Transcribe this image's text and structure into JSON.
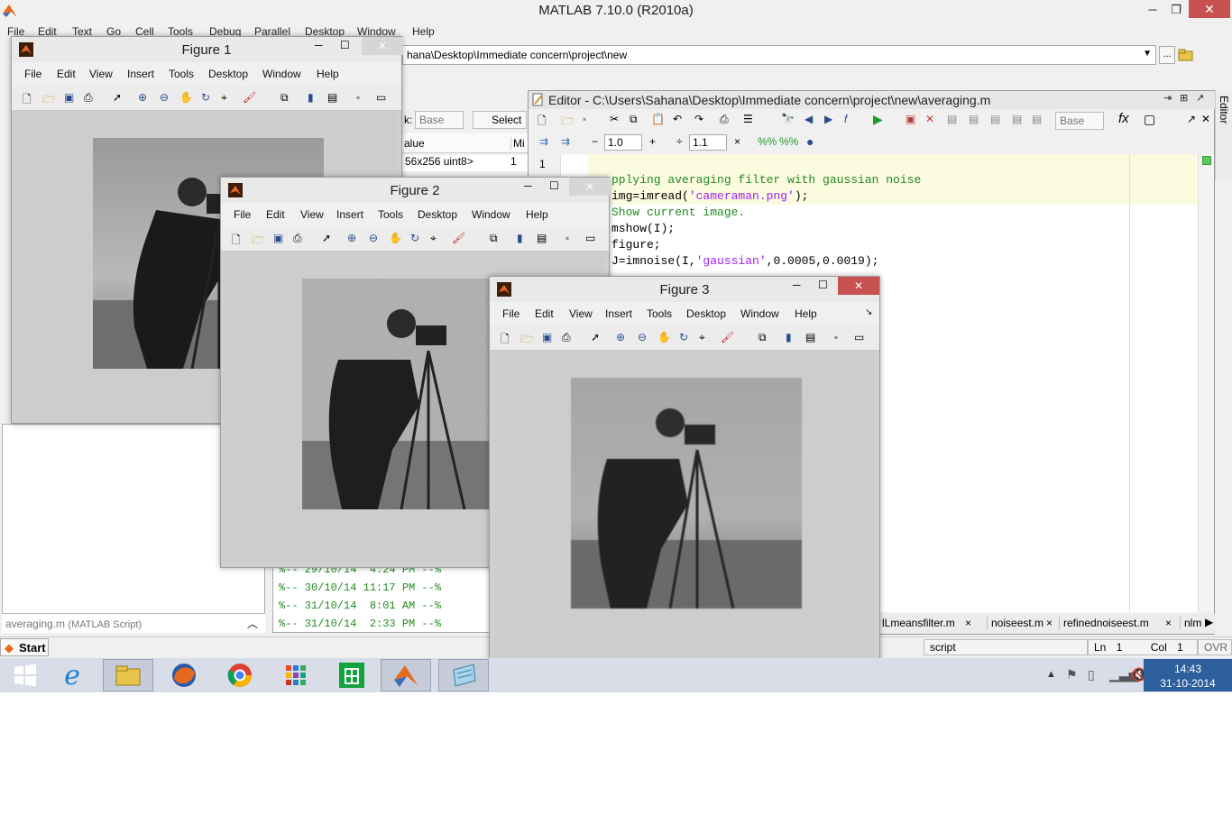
{
  "app": {
    "title": "MATLAB  7.10.0 (R2010a)",
    "menu": [
      "File",
      "Edit",
      "Text",
      "Go",
      "Cell",
      "Tools",
      "Debug",
      "Parallel",
      "Desktop",
      "Window",
      "Help"
    ],
    "current_folder": "hana\\Desktop\\Immediate concern\\project\\new",
    "browse_label": "..."
  },
  "workspace": {
    "stack_label": "k:",
    "stack_value": "Base",
    "select_label": "Select",
    "col_value": "alue",
    "col_min": "Mi",
    "rows": [
      {
        "value": "56x256 uint8>",
        "min": "1"
      }
    ]
  },
  "folder_details": {
    "file_label": "averaging.m",
    "file_type": "(MATLAB Script)"
  },
  "history": {
    "lines": [
      "%-- 29/10/14  4:24 PM --%",
      "%-- 30/10/14 11:17 PM --%",
      "%-- 31/10/14  8:01 AM --%",
      "%-- 31/10/14  2:33 PM --%"
    ]
  },
  "editor": {
    "title": "Editor - C:\\Users\\Sahana\\Desktop\\Immediate concern\\project\\new\\averaging.m",
    "stack_value": "Base",
    "cell_minus": "−",
    "cell_value1": "1.0",
    "cell_plus": "+",
    "cell_div": "÷",
    "cell_value2": "1.1",
    "cell_close": "×",
    "line_number": "1",
    "code": [
      {
        "type": "comment",
        "text": "pplying averaging filter with gaussian noise"
      },
      {
        "type": "mixed",
        "pre": "img=imread(",
        "str": "'cameraman.png'",
        "post": ");"
      },
      {
        "type": "comment",
        "text": "Show current image."
      },
      {
        "type": "plain",
        "text": "mshow(I);"
      },
      {
        "type": "plain",
        "text": "figure;"
      },
      {
        "type": "mixed",
        "pre": "J=imnoise(I,",
        "str": "'gaussian'",
        "post": ",0.0005,0.0019);"
      }
    ],
    "tabs": [
      {
        "label": "lLmeansfilter.m",
        "close": "×"
      },
      {
        "label": "noiseest.m",
        "close": "×"
      },
      {
        "label": "refinednoiseest.m",
        "close": "×"
      },
      {
        "label": "nlm",
        "close": ""
      }
    ],
    "side_label": "Editor"
  },
  "statusbar": {
    "start": "Start",
    "mode": "script",
    "ln_label": "Ln",
    "ln_value": "1",
    "col_label": "Col",
    "col_value": "1",
    "ovr": "OVR"
  },
  "figures": [
    {
      "title": "Figure 1",
      "menu": [
        "File",
        "Edit",
        "View",
        "Insert",
        "Tools",
        "Desktop",
        "Window",
        "Help"
      ]
    },
    {
      "title": "Figure 2",
      "menu": [
        "File",
        "Edit",
        "View",
        "Insert",
        "Tools",
        "Desktop",
        "Window",
        "Help"
      ]
    },
    {
      "title": "Figure 3",
      "menu": [
        "File",
        "Edit",
        "View",
        "Insert",
        "Tools",
        "Desktop",
        "Window",
        "Help"
      ]
    }
  ],
  "taskbar": {
    "apps": [
      "windows-icon",
      "internet-explorer-icon",
      "file-explorer-icon",
      "firefox-icon",
      "chrome-icon",
      "apps-grid-icon",
      "store-icon",
      "matlab-icon",
      "notepad-icon"
    ],
    "time": "14:43",
    "date": "31-10-2014"
  },
  "colors": {
    "comment": "#228b22",
    "string": "#a020f0",
    "close_button": "#c75050",
    "clock_bg": "#2d5f9c"
  }
}
